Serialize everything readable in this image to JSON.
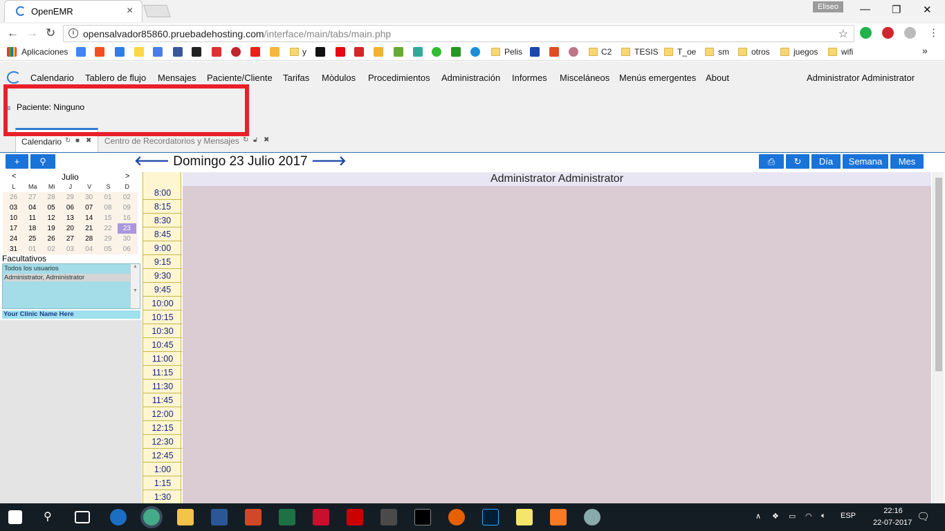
{
  "browser": {
    "tab_title": "OpenEMR",
    "profile": "Eliseo",
    "url_host": "opensalvador85860.pruebadehosting.com",
    "url_path": "/interface/main/tabs/main.php",
    "bookmarks": [
      "Aplicaciones",
      "y",
      "Pelis",
      "C2",
      "TESIS",
      "T_oe",
      "sm",
      "otros",
      "juegos",
      "wifi"
    ]
  },
  "menu": {
    "items": [
      "Calendario",
      "Tablero de flujo",
      "Mensajes",
      "Paciente/Cliente",
      "Tarifas",
      "Mòdulos",
      "Procedimientos",
      "Administración",
      "Informes",
      "Misceláneos",
      "Menús emergentes",
      "About"
    ],
    "user": "Administrator Administrator"
  },
  "patient": {
    "label": "Paciente: Ninguno"
  },
  "tabs": [
    {
      "label": "Calendario"
    },
    {
      "label": "Centro de Recordatorios y Mensajes"
    }
  ],
  "calendar": {
    "date_title": "Domingo 23 Julio 2017",
    "view_buttons": [
      "Día",
      "Semana",
      "Mes"
    ],
    "month": "Julio",
    "prev": "<",
    "next": ">",
    "weekdays": [
      "L",
      "Ma",
      "Mi",
      "J",
      "V",
      "S",
      "D"
    ],
    "weeks": [
      [
        "26",
        "27",
        "28",
        "29",
        "30",
        "01",
        "02"
      ],
      [
        "03",
        "04",
        "05",
        "06",
        "07",
        "08",
        "09"
      ],
      [
        "10",
        "11",
        "12",
        "13",
        "14",
        "15",
        "16"
      ],
      [
        "17",
        "18",
        "19",
        "20",
        "21",
        "22",
        "23"
      ],
      [
        "24",
        "25",
        "26",
        "27",
        "28",
        "29",
        "30"
      ],
      [
        "31",
        "01",
        "02",
        "03",
        "04",
        "05",
        "06"
      ]
    ],
    "selected_day": "23",
    "providers_label": "Facultativos",
    "providers": [
      "Todos los usuarios",
      "Administrator, Administrator"
    ],
    "clinic": "Your Clinic Name Here",
    "column_header": "Administrator Administrator",
    "times": [
      "8:00",
      "8:15",
      "8:30",
      "8:45",
      "9:00",
      "9:15",
      "9:30",
      "9:45",
      "10:00",
      "10:15",
      "10:30",
      "10:45",
      "11:00",
      "11:15",
      "11:30",
      "11:45",
      "12:00",
      "12:15",
      "12:30",
      "12:45",
      "1:00",
      "1:15",
      "1:30"
    ]
  },
  "taskbar": {
    "lang": "ESP",
    "time": "22:16",
    "date": "22-07-2017"
  },
  "colors": {
    "accent": "#1a73d8",
    "highlight": "#e8202a",
    "day_bg": "#dbcbd3",
    "time_bg": "#fdf6d0"
  }
}
